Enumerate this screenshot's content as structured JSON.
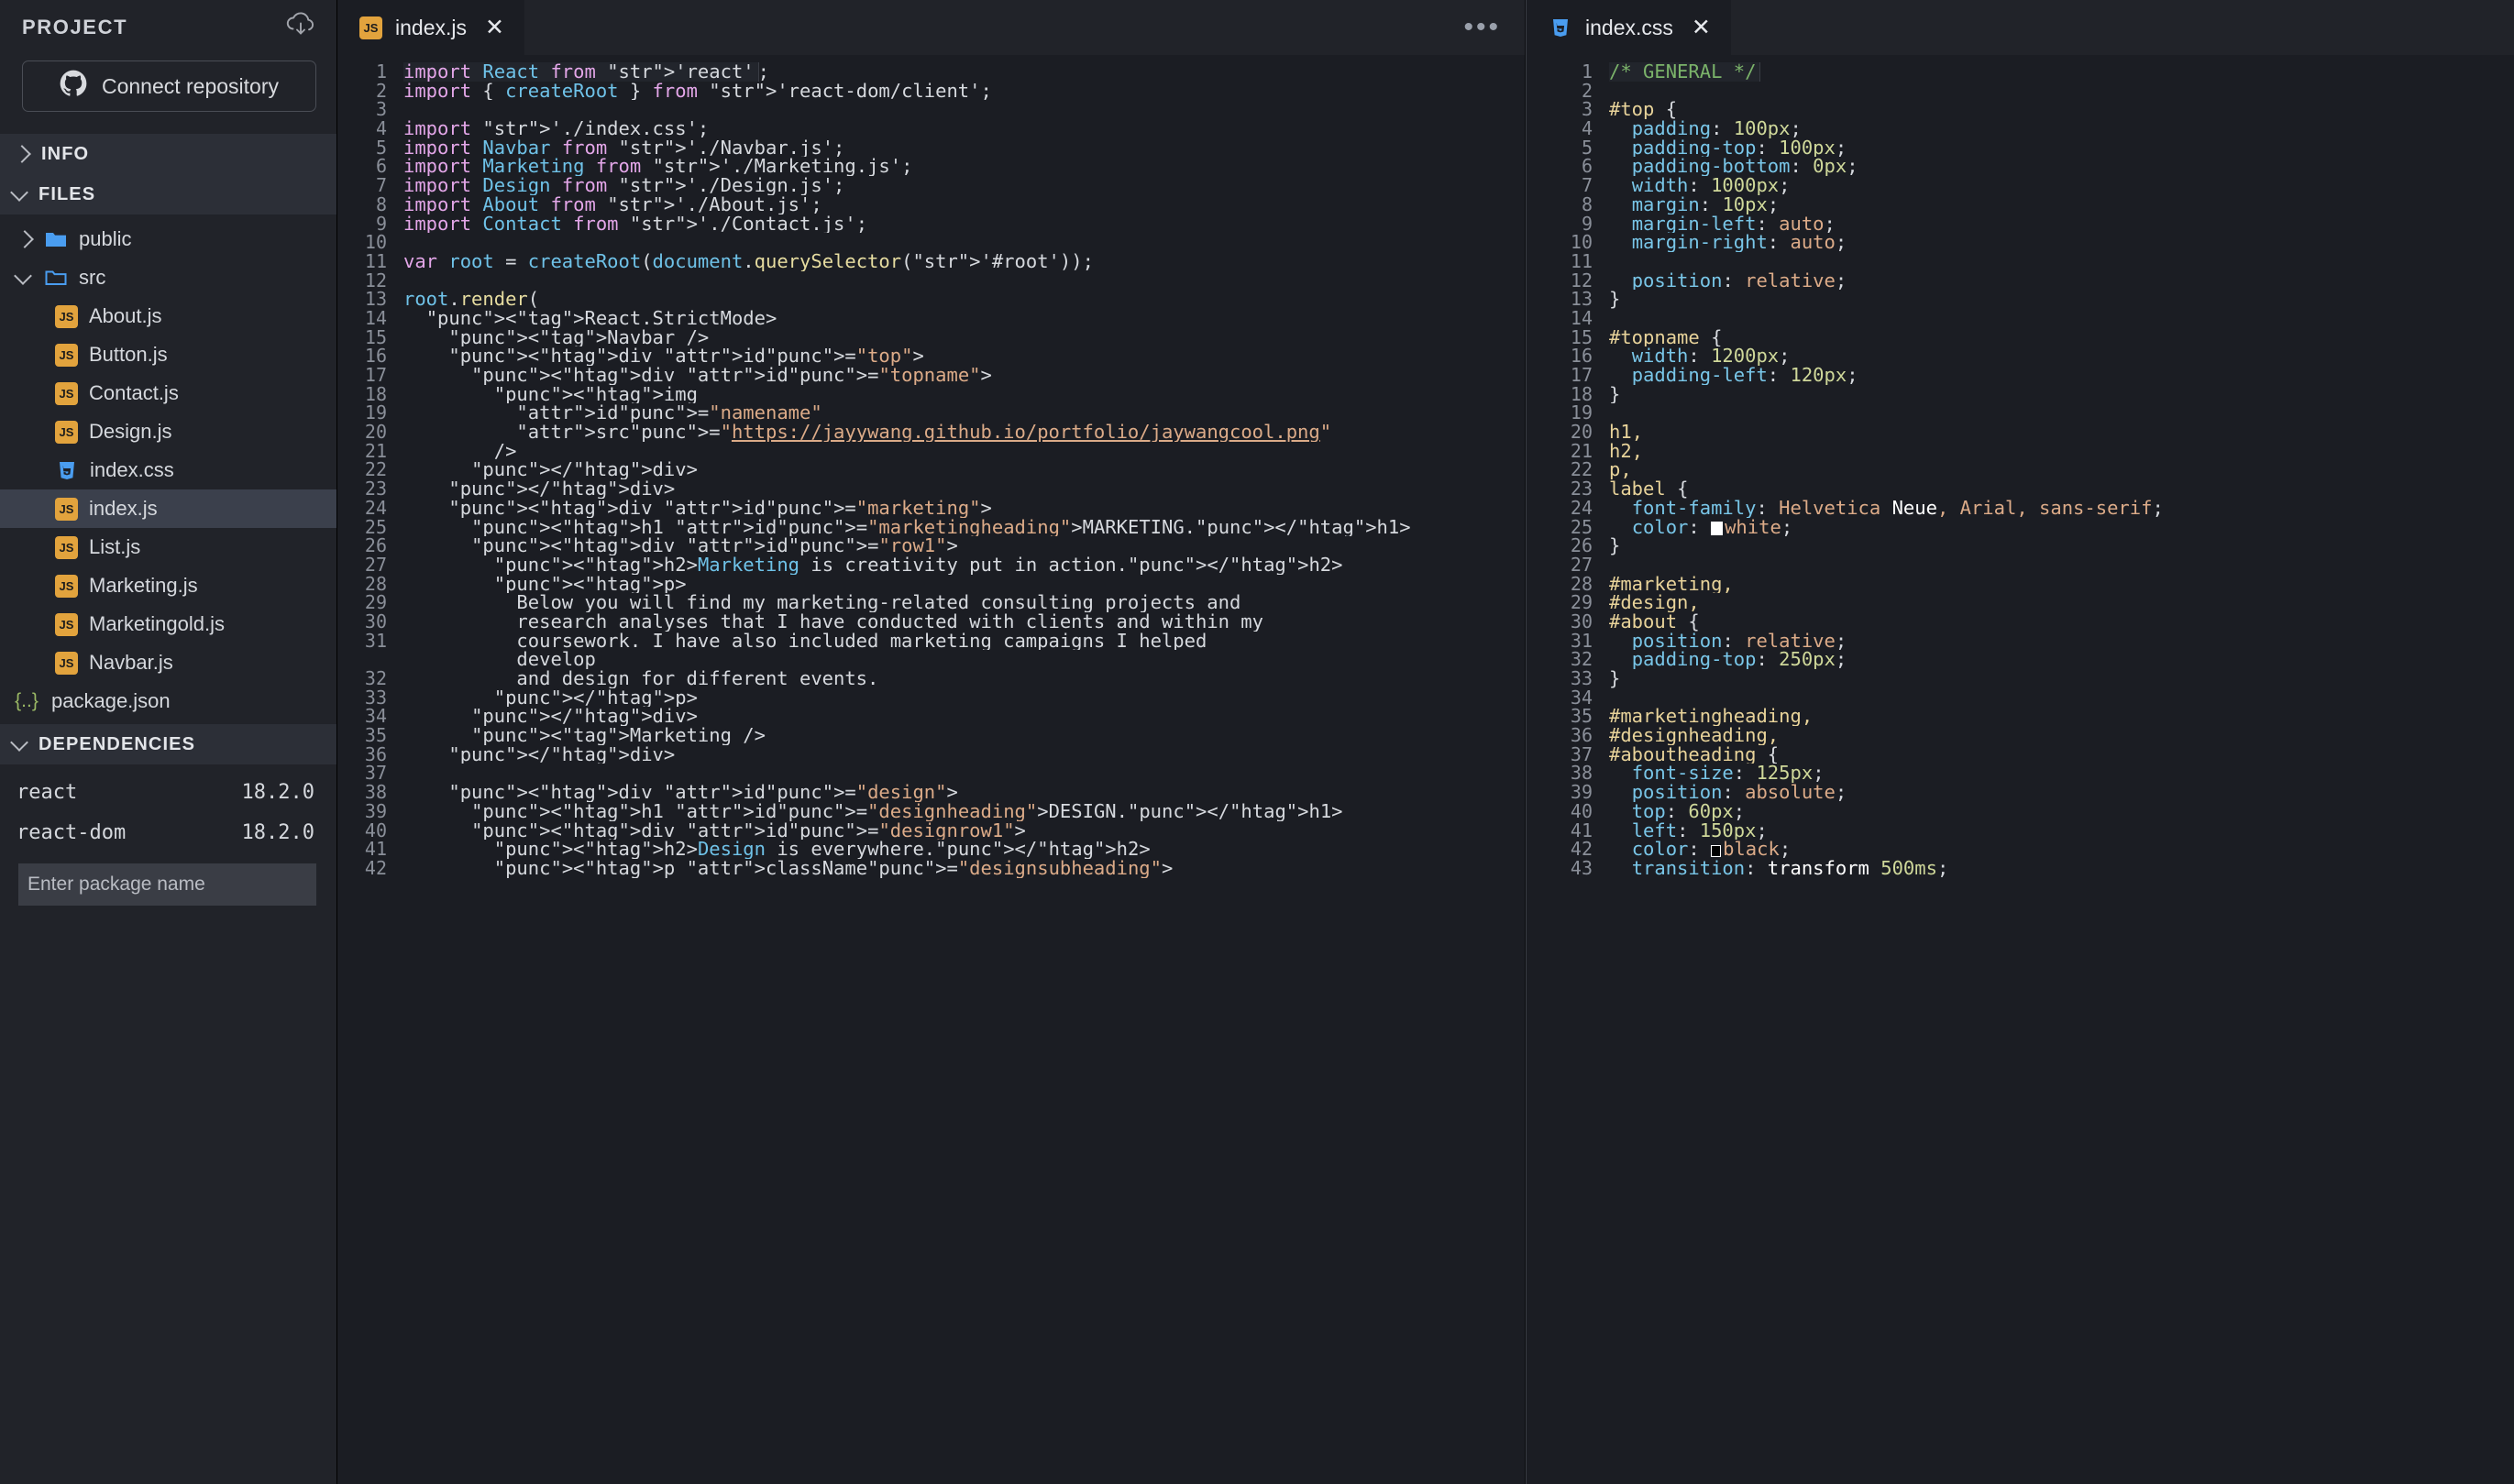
{
  "sidebar": {
    "header": {
      "title": "PROJECT",
      "download_icon": "cloud-download-icon"
    },
    "connect_button": {
      "label": "Connect repository",
      "icon": "github-icon"
    },
    "sections": [
      {
        "label": "INFO",
        "expanded": false
      },
      {
        "label": "FILES",
        "expanded": true
      },
      {
        "label": "DEPENDENCIES",
        "expanded": true
      }
    ],
    "files": [
      {
        "name": "public",
        "type": "folder",
        "expanded": false,
        "indent": 1
      },
      {
        "name": "src",
        "type": "folder",
        "expanded": true,
        "indent": 1
      },
      {
        "name": "About.js",
        "type": "js",
        "indent": 2
      },
      {
        "name": "Button.js",
        "type": "js",
        "indent": 2
      },
      {
        "name": "Contact.js",
        "type": "js",
        "indent": 2
      },
      {
        "name": "Design.js",
        "type": "js",
        "indent": 2
      },
      {
        "name": "index.css",
        "type": "css",
        "indent": 2
      },
      {
        "name": "index.js",
        "type": "js",
        "indent": 2,
        "selected": true
      },
      {
        "name": "List.js",
        "type": "js",
        "indent": 2
      },
      {
        "name": "Marketing.js",
        "type": "js",
        "indent": 2
      },
      {
        "name": "Marketingold.js",
        "type": "js",
        "indent": 2
      },
      {
        "name": "Navbar.js",
        "type": "js",
        "indent": 2
      },
      {
        "name": "package.json",
        "type": "json",
        "indent": 1
      }
    ],
    "dependencies": [
      {
        "name": "react",
        "version": "18.2.0"
      },
      {
        "name": "react-dom",
        "version": "18.2.0"
      }
    ],
    "package_input": {
      "placeholder": "Enter package name",
      "value": ""
    }
  },
  "editor_js": {
    "tab": {
      "label": "index.js",
      "icon": "js-file-icon",
      "close": "✕",
      "active": true
    },
    "overflow_menu": "•••",
    "lines": [
      {
        "n": "1",
        "current": true
      },
      {
        "n": "2"
      },
      {
        "n": "3"
      },
      {
        "n": "4"
      },
      {
        "n": "5"
      },
      {
        "n": "6"
      },
      {
        "n": "7"
      },
      {
        "n": "8"
      },
      {
        "n": "9"
      },
      {
        "n": "10"
      },
      {
        "n": "11"
      },
      {
        "n": "12"
      },
      {
        "n": "13"
      },
      {
        "n": "14"
      },
      {
        "n": "15"
      },
      {
        "n": "16"
      },
      {
        "n": "17"
      },
      {
        "n": "18"
      },
      {
        "n": "19"
      },
      {
        "n": "20"
      },
      {
        "n": "21"
      },
      {
        "n": "22"
      },
      {
        "n": "23"
      },
      {
        "n": "24"
      },
      {
        "n": "25"
      },
      {
        "n": "26"
      },
      {
        "n": "27"
      },
      {
        "n": "28"
      },
      {
        "n": "29"
      },
      {
        "n": "30"
      },
      {
        "n": "31"
      },
      {
        "n": ""
      },
      {
        "n": "32"
      },
      {
        "n": "33"
      },
      {
        "n": "34"
      },
      {
        "n": "35"
      },
      {
        "n": "36"
      },
      {
        "n": "37"
      },
      {
        "n": "38"
      },
      {
        "n": "39"
      },
      {
        "n": "40"
      },
      {
        "n": "41"
      },
      {
        "n": "42"
      }
    ],
    "text": [
      "import React from 'react';",
      "import { createRoot } from 'react-dom/client';",
      "",
      "import './index.css';",
      "import Navbar from './Navbar.js';",
      "import Marketing from './Marketing.js';",
      "import Design from './Design.js';",
      "import About from './About.js';",
      "import Contact from './Contact.js';",
      "",
      "var root = createRoot(document.querySelector('#root'));",
      "",
      "root.render(",
      "  <React.StrictMode>",
      "    <Navbar />",
      "    <div id=\"top\">",
      "      <div id=\"topname\">",
      "        <img",
      "          id=\"namename\"",
      "          src=\"https://jayywang.github.io/portfolio/jaywangcool.png\"",
      "        />",
      "      </div>",
      "    </div>",
      "    <div id=\"marketing\">",
      "      <h1 id=\"marketingheading\">MARKETING.</h1>",
      "      <div id=\"row1\">",
      "        <h2>Marketing is creativity put in action.</h2>",
      "        <p>",
      "          Below you will find my marketing-related consulting projects and",
      "          research analyses that I have conducted with clients and within my",
      "          coursework. I have also included marketing campaigns I helped",
      "          develop",
      "          and design for different events.",
      "        </p>",
      "      </div>",
      "      <Marketing />",
      "    </div>",
      "",
      "    <div id=\"design\">",
      "      <h1 id=\"designheading\">DESIGN.</h1>",
      "      <div id=\"designrow1\">",
      "        <h2>Design is everywhere.</h2>",
      "        <p className=\"designsubheading\">"
    ]
  },
  "editor_css": {
    "tab": {
      "label": "index.css",
      "icon": "css-file-icon",
      "close": "✕",
      "active": true
    },
    "lines": [
      "1",
      "2",
      "3",
      "4",
      "5",
      "6",
      "7",
      "8",
      "9",
      "10",
      "11",
      "12",
      "13",
      "14",
      "15",
      "16",
      "17",
      "18",
      "19",
      "20",
      "21",
      "22",
      "23",
      "24",
      "25",
      "26",
      "27",
      "28",
      "29",
      "30",
      "31",
      "32",
      "33",
      "34",
      "35",
      "36",
      "37",
      "38",
      "39",
      "40",
      "41",
      "42",
      "43"
    ],
    "text": [
      "/* GENERAL */",
      "",
      "#top {",
      "  padding: 100px;",
      "  padding-top: 100px;",
      "  padding-bottom: 0px;",
      "  width: 1000px;",
      "  margin: 10px;",
      "  margin-left: auto;",
      "  margin-right: auto;",
      "",
      "  position: relative;",
      "}",
      "",
      "#topname {",
      "  width: 1200px;",
      "  padding-left: 120px;",
      "}",
      "",
      "h1,",
      "h2,",
      "p,",
      "label {",
      "  font-family: Helvetica Neue, Arial, sans-serif;",
      "  color: white;",
      "}",
      "",
      "#marketing,",
      "#design,",
      "#about {",
      "  position: relative;",
      "  padding-top: 250px;",
      "}",
      "",
      "#marketingheading,",
      "#designheading,",
      "#aboutheading {",
      "  font-size: 125px;",
      "  position: absolute;",
      "  top: 60px;",
      "  left: 150px;",
      "  color: black;",
      "  transition: transform 500ms;"
    ],
    "current_line": "1"
  },
  "colors": {
    "sidebar_bg": "#212329",
    "section_bg": "#2c2f37",
    "selected_row": "#3b404c",
    "editor_bg": "#1b1d23",
    "js_icon": "#e2a33d",
    "css_icon": "#4a9df0",
    "folder_icon": "#4a9df0",
    "keyword": "#e3a6e8",
    "string": "#dcab88",
    "identifier": "#6fc2e8",
    "component_tag": "#6fd8b0",
    "comment": "#7bb36a",
    "css_selector": "#e8d39a",
    "css_property": "#79c6e8",
    "css_number": "#cfd89a"
  }
}
